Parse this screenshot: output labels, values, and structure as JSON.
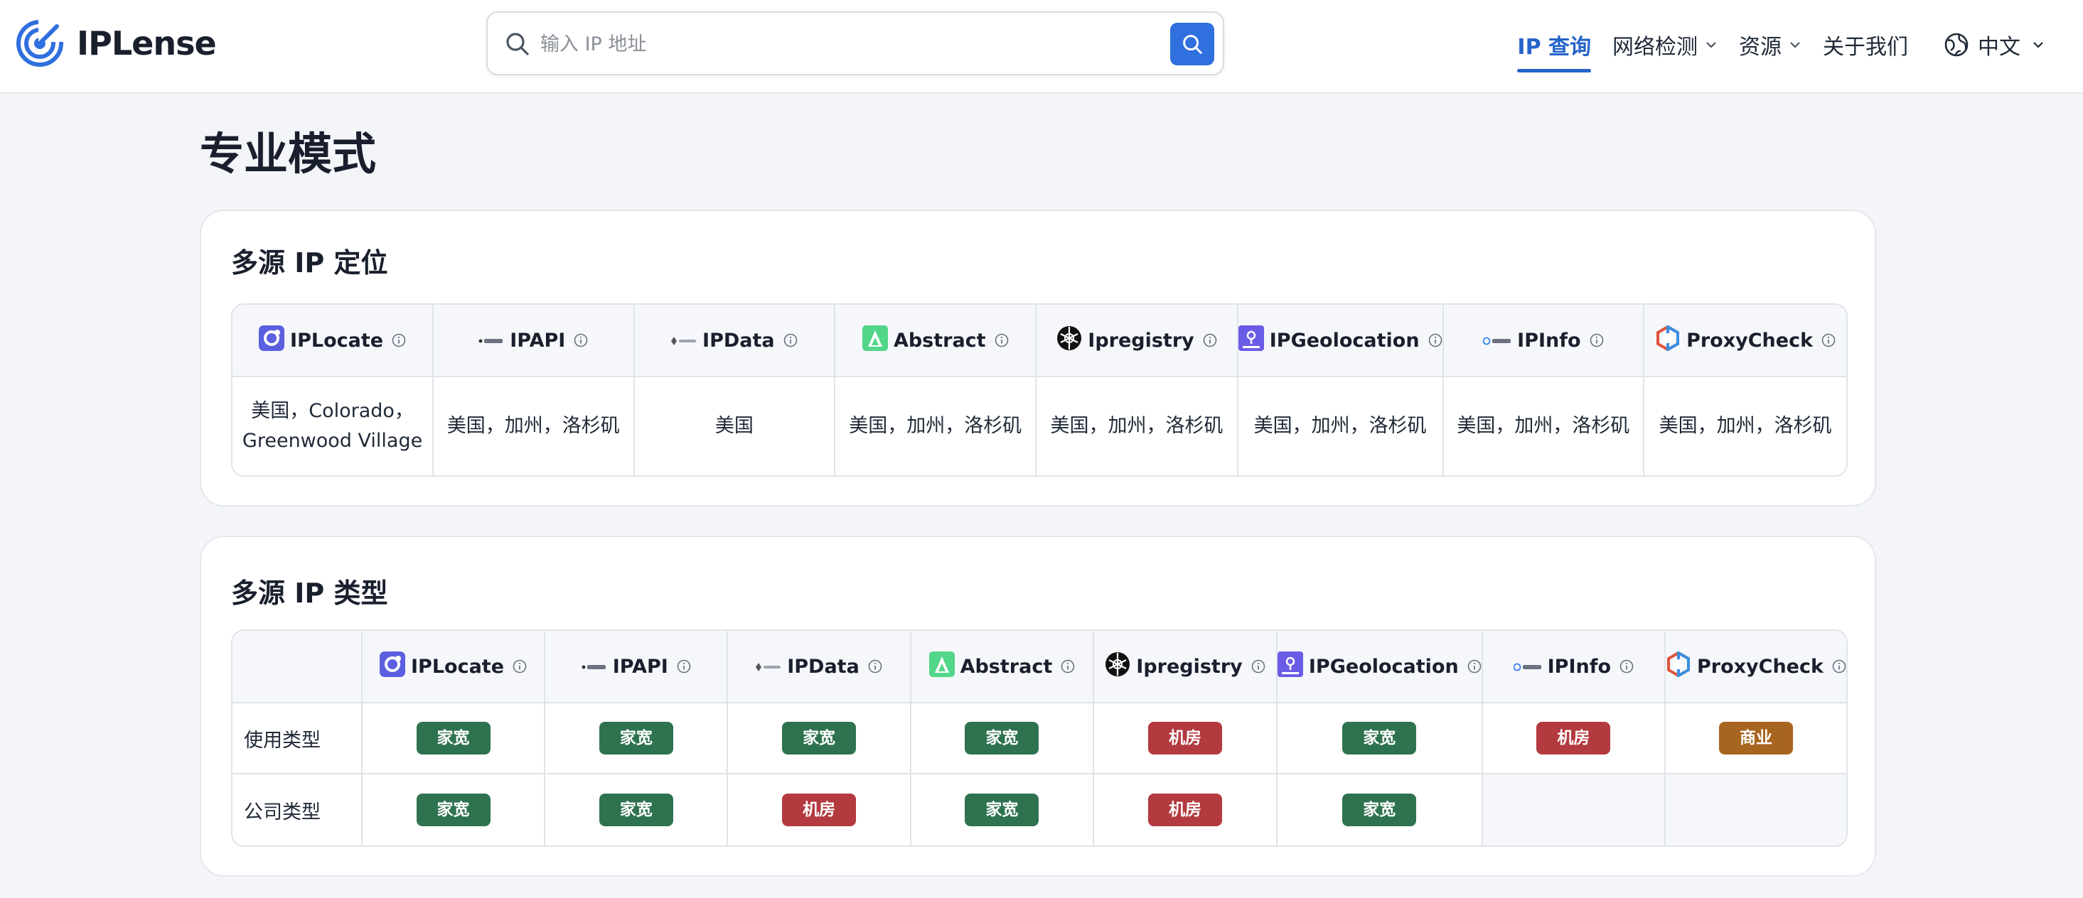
{
  "brand": {
    "name": "IPLense",
    "logo_icon": "radar-target-icon",
    "accent": "#2f6fde"
  },
  "search": {
    "placeholder": "输入 IP 地址",
    "value": "",
    "button_icon": "search-icon"
  },
  "nav": {
    "items": [
      {
        "label": "IP 查询",
        "active": true,
        "dropdown": false
      },
      {
        "label": "网络检测",
        "active": false,
        "dropdown": true
      },
      {
        "label": "资源",
        "active": false,
        "dropdown": true
      },
      {
        "label": "关于我们",
        "active": false,
        "dropdown": false
      }
    ],
    "language": {
      "label": "中文",
      "icon": "globe-icon"
    }
  },
  "page": {
    "title": "专业模式"
  },
  "providers": [
    "IPLocate",
    "IPAPI",
    "IPData",
    "Abstract",
    "Ipregistry",
    "IPGeolocation",
    "IPInfo",
    "ProxyCheck"
  ],
  "location_section": {
    "title": "多源 IP 定位",
    "values": [
      "美国，Colorado，Greenwood Village",
      "美国，加州，洛杉矶",
      "美国",
      "美国，加州，洛杉矶",
      "美国，加州，洛杉矶",
      "美国，加州，洛杉矶",
      "美国，加州，洛杉矶",
      "美国，加州，洛杉矶"
    ]
  },
  "type_section": {
    "title": "多源 IP 类型",
    "rows": [
      {
        "label": "使用类型",
        "values": [
          "家宽",
          "家宽",
          "家宽",
          "家宽",
          "机房",
          "家宽",
          "机房",
          "商业"
        ]
      },
      {
        "label": "公司类型",
        "values": [
          "家宽",
          "家宽",
          "机房",
          "家宽",
          "机房",
          "家宽",
          "",
          ""
        ]
      }
    ]
  },
  "tag_colors": {
    "家宽": "#2e7250",
    "机房": "#b33a3f",
    "商业": "#a8651f"
  }
}
